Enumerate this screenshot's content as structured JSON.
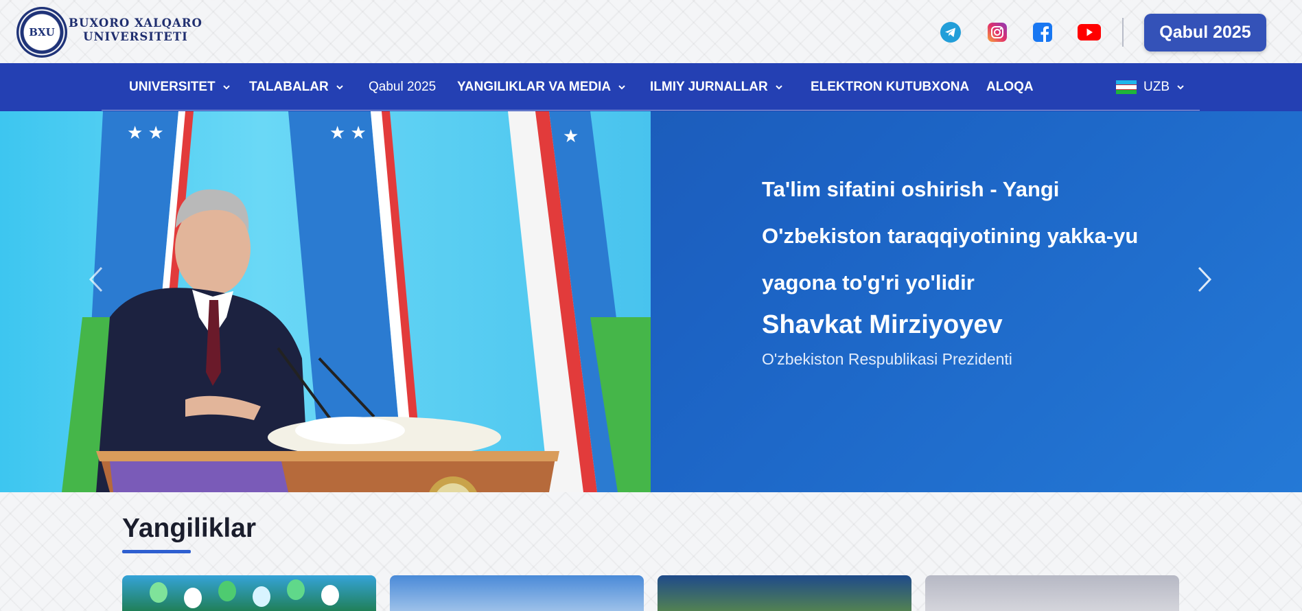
{
  "header": {
    "logo_text": "BXU",
    "brand_line1": "BUXORO XALQARO",
    "brand_line2": "UNIVERSITETI",
    "socials": [
      "telegram-icon",
      "instagram-icon",
      "facebook-icon",
      "youtube-icon"
    ],
    "apply_button": "Qabul 2025"
  },
  "nav": {
    "items": [
      {
        "label": "UNIVERSITET",
        "dropdown": true
      },
      {
        "label": "TALABALAR",
        "dropdown": true
      },
      {
        "label": "Qabul 2025",
        "dropdown": false
      },
      {
        "label": "YANGILIKLAR VA MEDIA",
        "dropdown": true
      },
      {
        "label": "ILMIY JURNALLAR",
        "dropdown": true
      },
      {
        "label": "ELEKTRON KUTUBXONA",
        "dropdown": false
      },
      {
        "label": "ALOQA",
        "dropdown": false
      }
    ],
    "language": "UZB"
  },
  "hero": {
    "quote_line1": "Ta'lim sifatini oshirish - Yangi",
    "quote_line2": "O'zbekiston taraqqiyotining yakka-yu",
    "quote_line3": "yagona to'g'ri yo'lidir",
    "author": "Shavkat Mirziyoyev",
    "role": "O'zbekiston Respublikasi Prezidenti"
  },
  "news": {
    "title": "Yangiliklar"
  },
  "colors": {
    "nav_bg": "#2440b3",
    "button_bg": "#3452b8",
    "accent": "#2e5fd0"
  }
}
